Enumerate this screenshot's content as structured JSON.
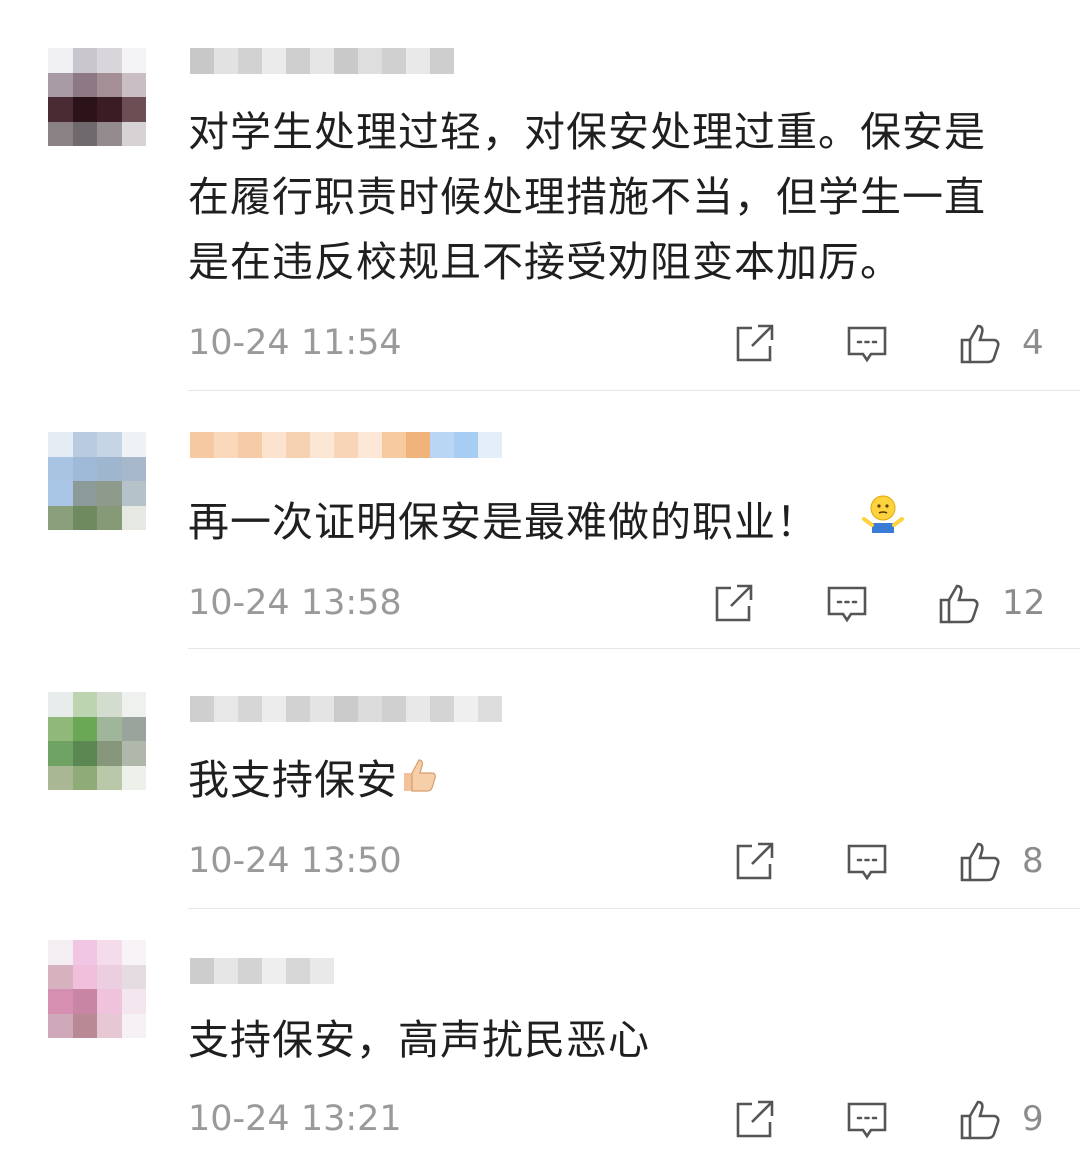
{
  "comments": [
    {
      "text_lines": [
        "对学生处理过轻，对保安处理过重。保安是",
        "在履行职责时候处理措施不当，但学生一直",
        "是在违反校规且不接受劝阻变本加厉。"
      ],
      "time": "10-24 11:54",
      "likes": "4"
    },
    {
      "text": "再一次证明保安是最难做的职业！",
      "emoji": "shrug-emoji",
      "time": "10-24 13:58",
      "likes": "12"
    },
    {
      "text": "我支持保安",
      "emoji": "thumbs-up-emoji",
      "time": "10-24 13:50",
      "likes": "8"
    },
    {
      "text": "支持保安，高声扰民恶心",
      "time": "10-24 13:21",
      "likes": "9"
    }
  ],
  "icons": {
    "share": "share-icon",
    "reply": "comment-icon",
    "like": "thumbs-up-icon"
  },
  "colors": {
    "text": "#1f1f1f",
    "meta": "#9a9a9a",
    "divider": "#e6e6e6"
  }
}
